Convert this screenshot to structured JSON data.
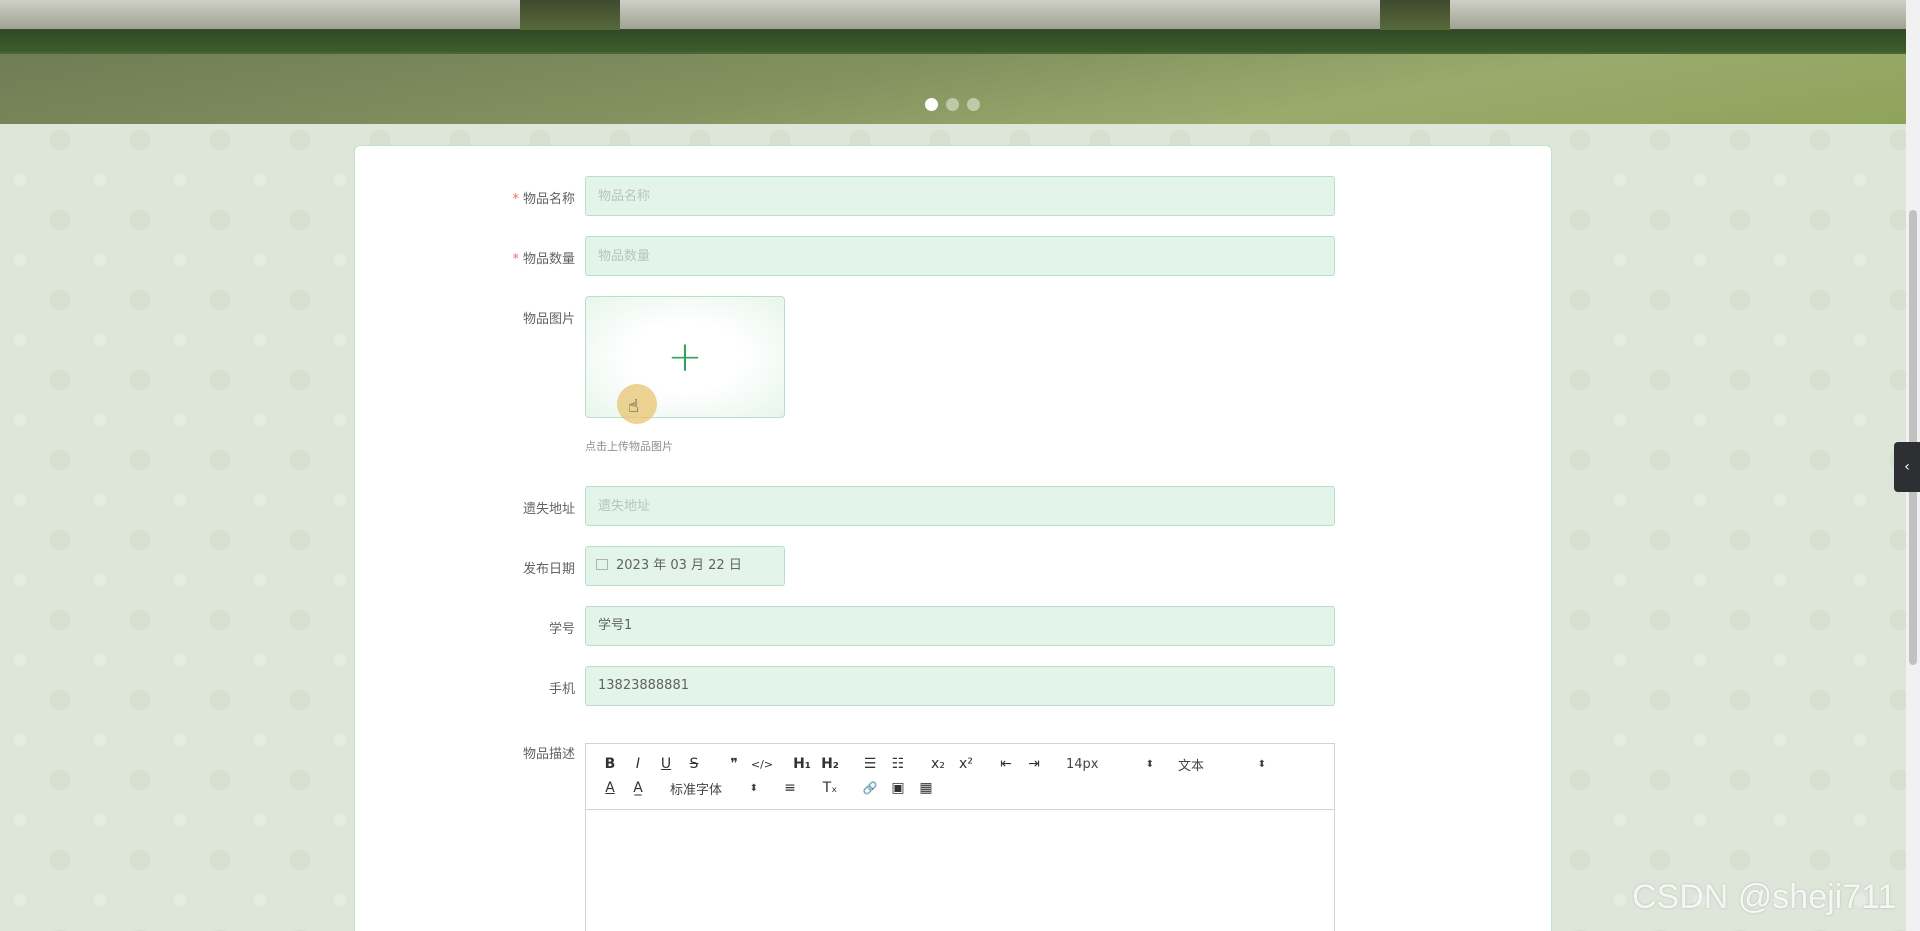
{
  "banner": {
    "slides": 3,
    "active_slide": 1
  },
  "form": {
    "item_name": {
      "label": "物品名称",
      "required": true,
      "placeholder": "物品名称",
      "value": ""
    },
    "item_quantity": {
      "label": "物品数量",
      "required": true,
      "placeholder": "物品数量",
      "value": ""
    },
    "item_image": {
      "label": "物品图片",
      "tip": "点击上传物品图片"
    },
    "lost_address": {
      "label": "遗失地址",
      "placeholder": "遗失地址",
      "value": ""
    },
    "publish_date": {
      "label": "发布日期",
      "value": "2023 年 03 月 22 日"
    },
    "student_id": {
      "label": "学号",
      "value": "学号1"
    },
    "phone": {
      "label": "手机",
      "value": "13823888881"
    },
    "description": {
      "label": "物品描述"
    }
  },
  "editor": {
    "font_size": "14px",
    "header_select": "文本",
    "font_family": "标准字体",
    "buttons_row1": [
      "B",
      "I",
      "U",
      "S",
      "❞",
      "</>",
      "H₁",
      "H₂",
      "☰",
      "☷",
      "x₂",
      "x²",
      "⇤",
      "⇥"
    ],
    "buttons_row2": [
      "A",
      "A̲",
      "≡",
      "Tₓ",
      "🔗",
      "▣",
      "▦"
    ]
  },
  "watermark": "CSDN @sheji711",
  "side_toggle": "‹"
}
